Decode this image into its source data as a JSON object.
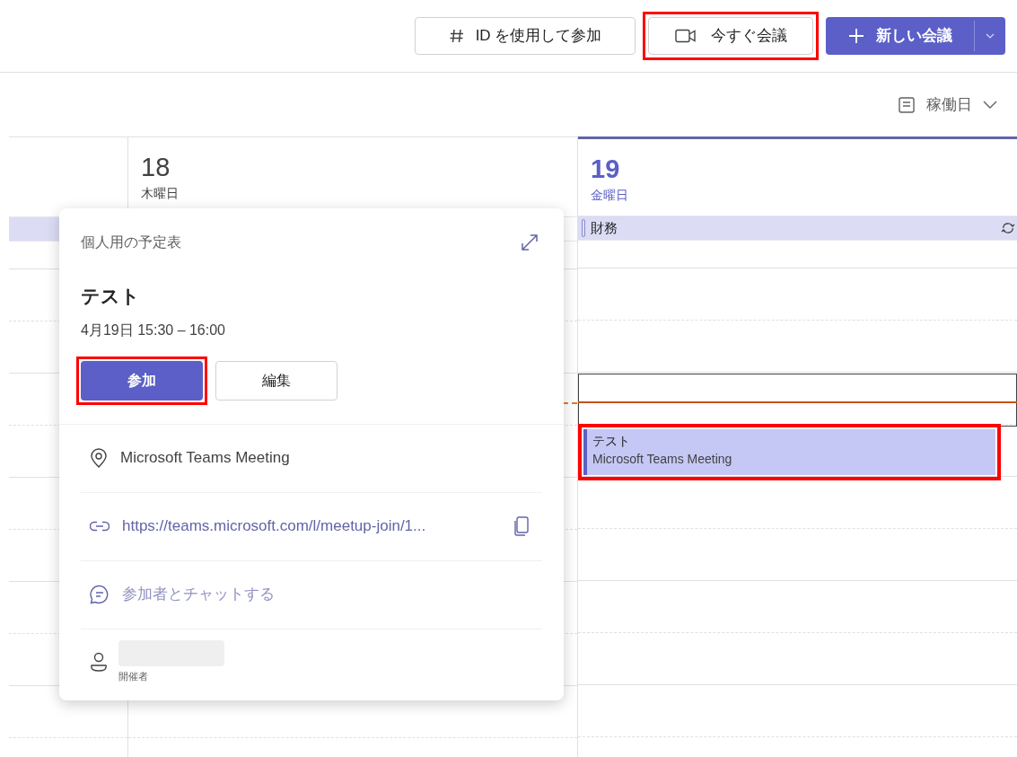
{
  "toolbar": {
    "buttons": [
      {
        "kind": "join_id",
        "label": "ID を使用して参加",
        "highlighted": false
      },
      {
        "kind": "meet_now",
        "label": "今すぐ会議",
        "highlighted": true
      },
      {
        "kind": "new_meeting",
        "label": "新しい会議",
        "highlighted": false
      }
    ]
  },
  "view_selector": {
    "label": "稼働日"
  },
  "days": [
    {
      "number": "18",
      "weekday": "木曜日",
      "selected": false
    },
    {
      "number": "19",
      "weekday": "金曜日",
      "selected": true,
      "all_day": [
        {
          "title": "財務",
          "recurring": true
        }
      ],
      "events": [
        {
          "title": "テスト",
          "location": "Microsoft Teams Meeting",
          "highlighted": true
        }
      ]
    }
  ],
  "popup": {
    "calendar": "個人用の予定表",
    "title": "テスト",
    "time": "4月19日 15:30 – 16:00",
    "buttons": [
      {
        "kind": "join",
        "label": "参加",
        "highlighted": true
      },
      {
        "kind": "edit",
        "label": "編集",
        "highlighted": false
      }
    ],
    "details": [
      {
        "kind": "location",
        "text": "Microsoft Teams Meeting"
      },
      {
        "kind": "link",
        "text": "https://teams.microsoft.com/l/meetup-join/1..."
      },
      {
        "kind": "chat",
        "text": "参加者とチャットする"
      }
    ],
    "organizer": {
      "role": "開催者"
    }
  }
}
